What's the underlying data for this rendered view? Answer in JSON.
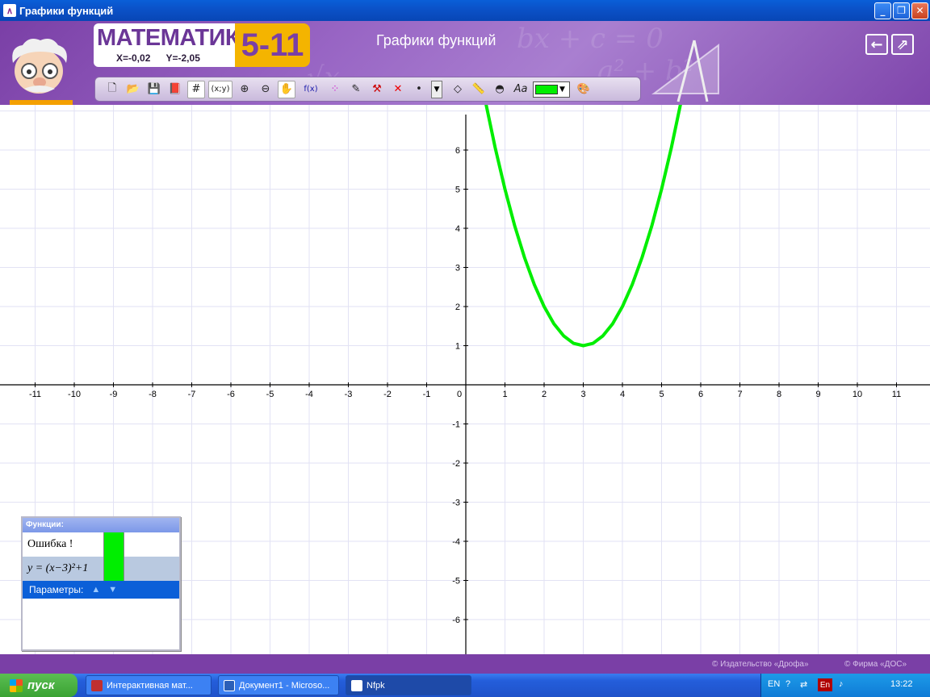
{
  "window": {
    "title": "Графики функций"
  },
  "header": {
    "logo_text": "МАТЕМАТИКА",
    "logo_grades": "5-11",
    "coord_x": "X=-0,02",
    "coord_y": "Y=-2,05",
    "app_title": "Графики функций",
    "back_icon": "arrow-left-icon",
    "expand_icon": "expand-icon"
  },
  "toolbar": {
    "coords_label": "(x;y)",
    "fx_label": "f(x)",
    "dot_label": "•",
    "text_label": "Aa",
    "line_color": "#00ee00"
  },
  "axes": {
    "x_ticks": [
      "-11",
      "-10",
      "-9",
      "-8",
      "-7",
      "-6",
      "-5",
      "-4",
      "-3",
      "-2",
      "-1",
      "0",
      "1",
      "2",
      "3",
      "4",
      "5",
      "6",
      "7",
      "8",
      "9",
      "10",
      "11"
    ],
    "y_ticks": [
      "6",
      "5",
      "4",
      "3",
      "2",
      "1",
      "-1",
      "-2",
      "-3",
      "-4",
      "-5",
      "-6"
    ]
  },
  "chart_data": {
    "type": "line",
    "series": [
      {
        "color": "#00ee00",
        "x": [
          0.5,
          0.75,
          1,
          1.25,
          1.5,
          1.75,
          2,
          2.25,
          2.5,
          2.75,
          3,
          3.25,
          3.5,
          3.75,
          4,
          4.25,
          4.5,
          4.75,
          5,
          5.25,
          5.5
        ],
        "y": [
          7.25,
          6.06,
          5,
          4.06,
          3.25,
          2.56,
          2,
          1.56,
          1.25,
          1.06,
          1,
          1.06,
          1.25,
          1.56,
          2,
          2.56,
          3.25,
          4.06,
          5,
          6.06,
          7.25
        ]
      }
    ],
    "xlim": [
      -12,
      12
    ],
    "ylim": [
      -7,
      7
    ],
    "grid": true
  },
  "functions_panel": {
    "header": "Функции:",
    "rows": [
      {
        "text": "Ошибка !",
        "color": "#00ee00"
      },
      {
        "text": "y = (x−3)²+1",
        "color": "#00ee00"
      }
    ],
    "params_label": "Параметры:"
  },
  "footer": {
    "publisher": "© Издательство «Дрофа»",
    "company": "© Фирма «ДОС»"
  },
  "taskbar": {
    "start_label": "пуск",
    "tasks": [
      {
        "label": "Интерактивная мат..."
      },
      {
        "label": "Документ1 - Microso..."
      },
      {
        "label": "Nfpk"
      }
    ],
    "tray_lang": "EN",
    "tray_lang2": "En",
    "clock": "13:22"
  }
}
